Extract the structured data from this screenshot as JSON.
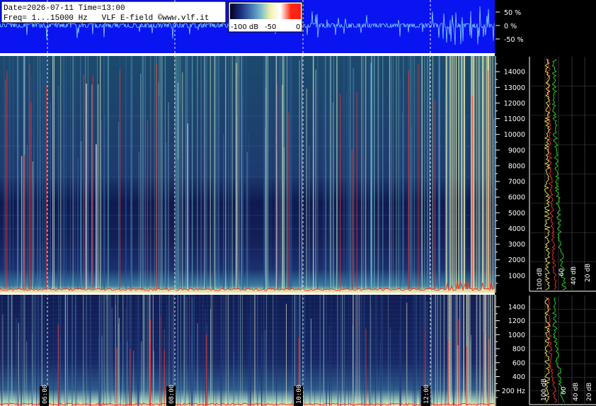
{
  "header": {
    "line1": "Date=2026-07-11 Time=13:00",
    "line2": "Freq= 1...15000 Hz   VLF E-field ©www.vlf.it"
  },
  "colorbar": {
    "labels": [
      "-100 dB",
      "-50",
      "0"
    ],
    "stops": [
      "#000020",
      "#1a2a78",
      "#3f6fb0",
      "#78b8c8",
      "#f2f2b0",
      "#ffffff",
      "#ff2a10",
      "#ff1a1a"
    ]
  },
  "waveform": {
    "ticks": [
      "50 %",
      "0 %",
      "-50 %"
    ],
    "background": "#0a14f0",
    "trace_color": "#7fd0ff"
  },
  "time_axis": {
    "labels": [
      "06:00",
      "08:00",
      "10:00",
      "12:00"
    ]
  },
  "freq_axis_top": {
    "labels": [
      "14000",
      "13000",
      "12000",
      "11000",
      "10000",
      "9000",
      "8000",
      "7000",
      "6000",
      "5000",
      "4000",
      "3000",
      "2000",
      "1000"
    ]
  },
  "freq_axis_bottom": {
    "labels": [
      "1400",
      "1200",
      "1000",
      "800",
      "600",
      "400",
      "200 Hz"
    ]
  },
  "spectrum_axis_top": {
    "labels": [
      "100 dB",
      "60",
      "40 dB",
      "20 dB"
    ]
  },
  "spectrum_axis_bottom": {
    "labels": [
      "100 dB",
      "60",
      "40 dB",
      "20 dB"
    ]
  },
  "chart_data": [
    {
      "type": "heatmap",
      "title": "",
      "xlabel": "",
      "ylabel": "",
      "x_ticks": [
        "06:00",
        "08:00",
        "10:00",
        "12:00"
      ],
      "y_ticks": [
        14000,
        13000,
        12000,
        11000,
        10000,
        9000,
        8000,
        7000,
        6000,
        5000,
        4000,
        3000,
        2000,
        1000
      ],
      "ylim": [
        0,
        15000
      ],
      "value_range_db": [
        -100,
        0
      ]
    },
    {
      "type": "heatmap",
      "title": "",
      "xlabel": "",
      "ylabel": "",
      "x_ticks": [
        "06:00",
        "08:00",
        "10:00",
        "12:00"
      ],
      "y_ticks": [
        1400,
        1200,
        1000,
        800,
        600,
        400,
        200
      ],
      "ylim": [
        0,
        1500
      ],
      "value_range_db": [
        -100,
        0
      ]
    },
    {
      "type": "line",
      "title": "",
      "xlabel": "",
      "ylabel": "",
      "x_ticks": [
        "100 dB",
        "60",
        "40 dB",
        "20 dB"
      ],
      "y_ticks": [
        14000,
        13000,
        12000,
        11000,
        10000,
        9000,
        8000,
        7000,
        6000,
        5000,
        4000,
        3000,
        2000,
        1000
      ]
    },
    {
      "type": "line",
      "title": "",
      "xlabel": "",
      "ylabel": "",
      "x_ticks": [
        "100 dB",
        "60",
        "40 dB",
        "20 dB"
      ],
      "y_ticks": [
        1400,
        1200,
        1000,
        800,
        600,
        400,
        200
      ]
    }
  ]
}
